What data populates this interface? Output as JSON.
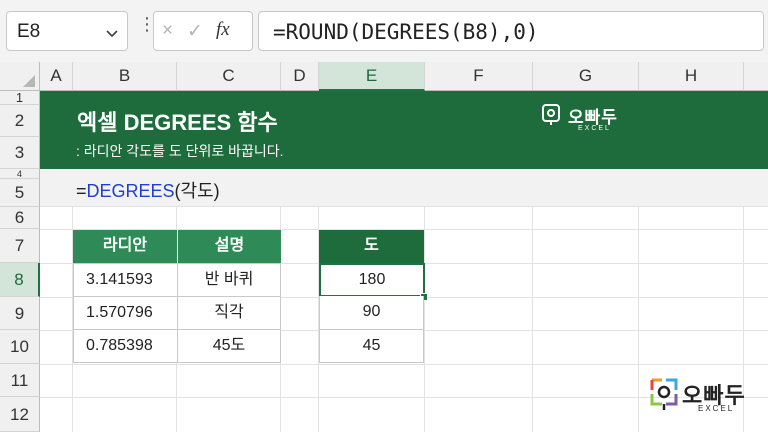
{
  "name_box": {
    "value": "E8"
  },
  "formula_bar": {
    "cancel_icon": "×",
    "enter_icon": "✓",
    "fx_label": "fx",
    "formula": "=ROUND(DEGREES(B8),0)"
  },
  "columns": [
    "A",
    "B",
    "C",
    "D",
    "E",
    "F",
    "G",
    "H"
  ],
  "selected_column": "E",
  "rows": [
    "1",
    "2",
    "3",
    "4",
    "5",
    "6",
    "7",
    "8",
    "9",
    "10",
    "11",
    "12"
  ],
  "selected_row": "8",
  "banner": {
    "title": "엑셀 DEGREES 함수",
    "subtitle": ": 라디안 각도를 도 단위로 바꿉니다.",
    "logo_text": "오빠두",
    "logo_sub": "EXCEL",
    "background": "#1e6b3c"
  },
  "syntax": {
    "eq": "=",
    "func": "DEGREES",
    "args": "(각도)"
  },
  "table1": {
    "headers": [
      "라디안",
      "설명"
    ],
    "rows": [
      [
        "3.141593",
        "반 바퀴"
      ],
      [
        "1.570796",
        "직각"
      ],
      [
        "0.785398",
        "45도"
      ]
    ]
  },
  "table2": {
    "header": "도",
    "values": [
      "180",
      "90",
      "45"
    ]
  },
  "footer_logo": {
    "text": "오빠두",
    "sub": "EXCEL"
  }
}
